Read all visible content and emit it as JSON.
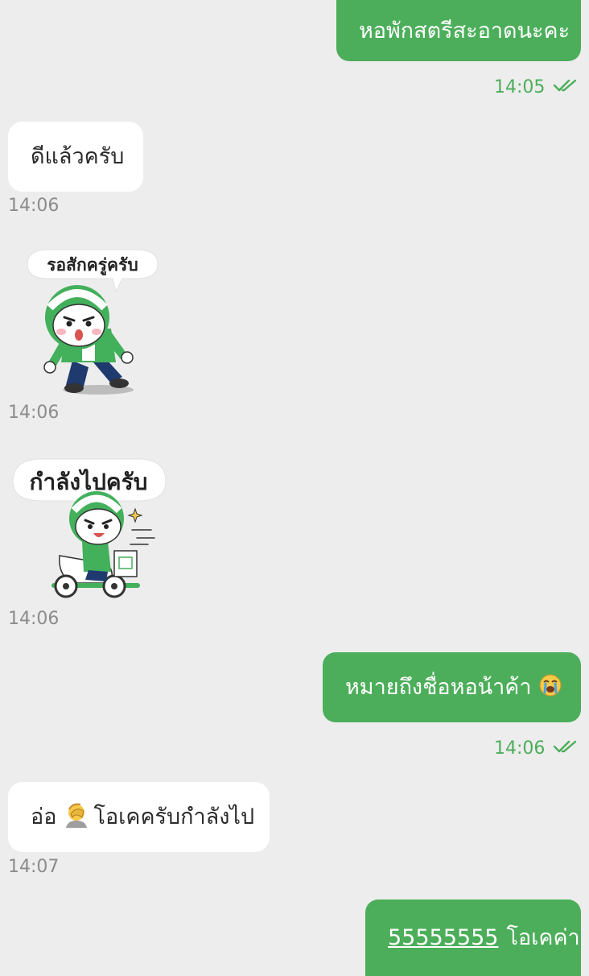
{
  "colors": {
    "background": "#ededed",
    "outgoing_bubble": "#4cae5a",
    "incoming_bubble": "#ffffff",
    "outgoing_time": "#4cae5a",
    "incoming_time": "#8c8c8c"
  },
  "messages": [
    {
      "direction": "out",
      "text": "หอพักสตรีสะอาดนะคะ",
      "time": "14:05",
      "status_icon": "double-check-icon"
    },
    {
      "direction": "in",
      "text": "ดีแล้วครับ",
      "time": "14:06"
    },
    {
      "direction": "in",
      "type": "sticker",
      "sticker_text": "รอสักครู่ครับ",
      "time": "14:06"
    },
    {
      "direction": "in",
      "type": "sticker",
      "sticker_text": "กำลังไปครับ",
      "time": "14:06"
    },
    {
      "direction": "out",
      "text": "หมายถึงชื่อหอน้าค้า",
      "emoji": "loudly-crying-face-emoji",
      "time": "14:06",
      "status_icon": "double-check-icon"
    },
    {
      "direction": "in",
      "prefix": "อ่อ",
      "emoji": "facepalm-emoji",
      "text": "โอเคครับกำลังไป",
      "time": "14:07"
    },
    {
      "direction": "out",
      "link_text": "55555555",
      "text": "โอเคค่า"
    }
  ]
}
